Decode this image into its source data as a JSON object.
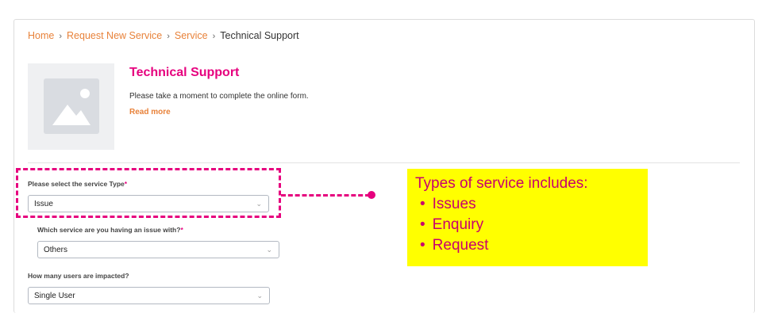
{
  "breadcrumb": {
    "items": [
      "Home",
      "Request New Service",
      "Service"
    ],
    "separator": "›",
    "current": "Technical Support"
  },
  "service": {
    "title": "Technical Support",
    "description": "Please take a moment to complete the online form.",
    "read_more": "Read more"
  },
  "form": {
    "service_type": {
      "label": "Please select the service Type",
      "required": "*",
      "value": "Issue"
    },
    "issue_with": {
      "label": "Which service are you having an issue with?",
      "required": "*",
      "value": "Others"
    },
    "users_impacted": {
      "label": "How many users are impacted?",
      "value": "Single User"
    }
  },
  "callout": {
    "heading": "Types of service includes:",
    "items": [
      "Issues",
      "Enquiry",
      "Request"
    ]
  },
  "colors": {
    "accent_pink": "#e6007e",
    "link_orange": "#e8823a",
    "callout_bg": "#ffff00"
  },
  "icons": {
    "thumbnail": "image-placeholder-icon",
    "dropdown": "chevron-down-icon"
  }
}
